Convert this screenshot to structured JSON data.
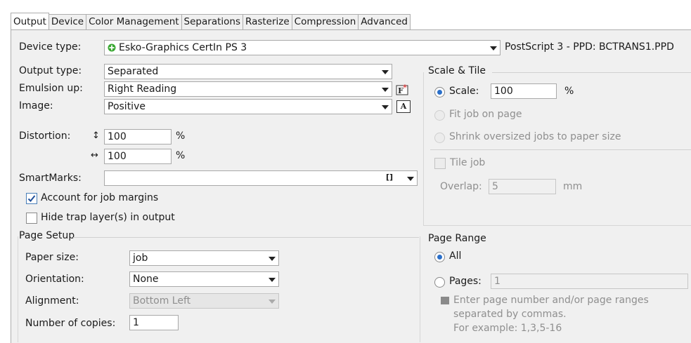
{
  "tabs": [
    "Output",
    "Device",
    "Color Management",
    "Separations",
    "Rasterize",
    "Compression",
    "Advanced"
  ],
  "device": {
    "label": "Device type:",
    "value": "Esko-Graphics CertIn PS 3",
    "ppd": "PostScript 3 - PPD: BCTRANS1.PPD"
  },
  "output_type": {
    "label": "Output type:",
    "value": "Separated"
  },
  "emulsion": {
    "label": "Emulsion up:",
    "value": "Right Reading"
  },
  "image": {
    "label": "Image:",
    "value": "Positive",
    "preview_glyph": "A"
  },
  "distortion": {
    "label": "Distortion:",
    "vertical_symbol": "↕",
    "horizontal_symbol": "↔",
    "vertical_value": "100",
    "horizontal_value": "100",
    "unit": "%"
  },
  "smartmarks": {
    "label": "SmartMarks:",
    "value": "",
    "bracket_glyph": "[]"
  },
  "account_margins": {
    "label": "Account for job margins",
    "checked": true
  },
  "hide_trap": {
    "label": "Hide trap layer(s) in output",
    "checked": false
  },
  "page_setup": {
    "title": "Page Setup",
    "paper_size": {
      "label": "Paper size:",
      "value": "job"
    },
    "orientation": {
      "label": "Orientation:",
      "value": "None"
    },
    "alignment": {
      "label": "Alignment:",
      "value": "Bottom Left"
    },
    "copies": {
      "label": "Number of copies:",
      "value": "1"
    }
  },
  "scale_tile": {
    "title": "Scale & Tile",
    "scale_label": "Scale:",
    "scale_value": "100",
    "scale_unit": "%",
    "fit_label": "Fit job on page",
    "shrink_label": "Shrink oversized jobs to paper size",
    "tile_label": "Tile job",
    "overlap_label": "Overlap:",
    "overlap_value": "5",
    "overlap_unit": "mm"
  },
  "page_range": {
    "title": "Page Range",
    "all_label": "All",
    "pages_label": "Pages:",
    "pages_value": "1",
    "hint_line1": "Enter page number and/or page ranges",
    "hint_line2": "separated by commas.",
    "hint_line3": "For example: 1,3,5-16"
  }
}
